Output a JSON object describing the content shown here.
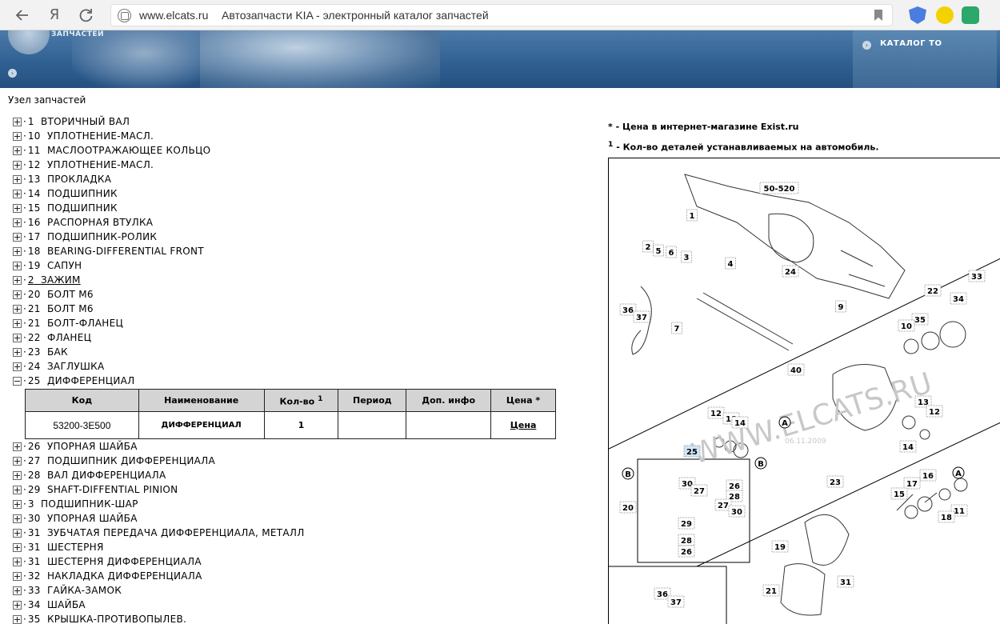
{
  "browser": {
    "back_icon": "arrow-left-icon",
    "yandex_label": "Я",
    "reload_icon": "reload-icon",
    "url": "www.elcats.ru",
    "page_title": "Автозапчасти KIA - электронный каталог запчастей"
  },
  "banner": {
    "brand_sub": "ЗАПЧАСТЕЙ",
    "catalog_to": "КАТАЛОГ ТО"
  },
  "section_title": "Узел запчастей",
  "tree_top": [
    {
      "num": "1",
      "label": "ВТОРИЧНЫЙ ВАЛ"
    },
    {
      "num": "10",
      "label": "УПЛОТНЕНИЕ-МАСЛ."
    },
    {
      "num": "11",
      "label": "МАСЛООТРАЖАЮЩЕЕ КОЛЬЦО"
    },
    {
      "num": "12",
      "label": "УПЛОТНЕНИЕ-МАСЛ."
    },
    {
      "num": "13",
      "label": "ПРОКЛАДКА"
    },
    {
      "num": "14",
      "label": "ПОДШИПНИК"
    },
    {
      "num": "15",
      "label": "ПОДШИПНИК"
    },
    {
      "num": "16",
      "label": "РАСПОРНАЯ ВТУЛКА"
    },
    {
      "num": "17",
      "label": "ПОДШИПНИК-РОЛИК"
    },
    {
      "num": "18",
      "label": "BEARING-DIFFERENTIAL FRONT"
    },
    {
      "num": "19",
      "label": "САПУН"
    },
    {
      "num": "2",
      "label": "ЗАЖИМ"
    },
    {
      "num": "20",
      "label": "БОЛТ М6"
    },
    {
      "num": "21",
      "label": "БОЛТ М6"
    },
    {
      "num": "21",
      "label": "БОЛТ-ФЛАНЕЦ"
    },
    {
      "num": "22",
      "label": "ФЛАНЕЦ"
    },
    {
      "num": "23",
      "label": "БАК"
    },
    {
      "num": "24",
      "label": "ЗАГЛУШКА"
    },
    {
      "num": "25",
      "label": "ДИФФЕРЕНЦИАЛ"
    }
  ],
  "parts_table": {
    "headers": {
      "code": "Код",
      "name": "Наименование",
      "qty": "Кол-во",
      "qty_sup": "1",
      "period": "Период",
      "info": "Доп. инфо",
      "price": "Цена *"
    },
    "row": {
      "code": "53200-3E500",
      "name": "ДИФФЕРЕНЦИАЛ",
      "qty": "1",
      "period": "",
      "info": "",
      "price": "Цена"
    }
  },
  "tree_bottom": [
    {
      "num": "26",
      "label": "УПОРНАЯ ШАЙБА"
    },
    {
      "num": "27",
      "label": "ПОДШИПНИК ДИФФЕРЕНЦИАЛА"
    },
    {
      "num": "28",
      "label": "ВАЛ ДИФФЕРЕНЦИАЛА"
    },
    {
      "num": "29",
      "label": "SHAFT-DIFFENTIAL PINION"
    },
    {
      "num": "3",
      "label": "ПОДШИПНИК-ШАР"
    },
    {
      "num": "30",
      "label": "УПОРНАЯ ШАЙБА"
    },
    {
      "num": "31",
      "label": "ЗУБЧАТАЯ ПЕРЕДАЧА ДИФФЕРЕНЦИАЛА, МЕТАЛЛ"
    },
    {
      "num": "31",
      "label": "ШЕСТЕРНЯ"
    },
    {
      "num": "31",
      "label": "ШЕСТЕРНЯ ДИФФЕРЕНЦИАЛА"
    },
    {
      "num": "32",
      "label": "НАКЛАДКА ДИФФЕРЕНЦИАЛА"
    },
    {
      "num": "33",
      "label": "ГАЙКА-ЗАМОК"
    },
    {
      "num": "34",
      "label": "ШАЙБА"
    },
    {
      "num": "35",
      "label": "КРЫШКА-ПРОТИВОПЫЛЕВ."
    }
  ],
  "notes": {
    "price_note": "* - Цена в интернет-магазине Exist.ru",
    "qty_sup": "1",
    "qty_note": " - Кол-во деталей устанавливаемых на автомобиль."
  },
  "diagram": {
    "watermark": "WWW.ELCATS.RU",
    "date_stamp": "06.11.2009",
    "callouts": [
      "50-520",
      "1",
      "2",
      "5",
      "6",
      "3",
      "4",
      "24",
      "33",
      "22",
      "34",
      "36",
      "37",
      "7",
      "9",
      "35",
      "10",
      "40",
      "13",
      "12",
      "14",
      "12",
      "13",
      "14",
      "25",
      "A",
      "B",
      "B",
      "A",
      "23",
      "30",
      "27",
      "26",
      "28",
      "20",
      "27",
      "30",
      "29",
      "28",
      "26",
      "16",
      "17",
      "15",
      "11",
      "18",
      "19",
      "36",
      "37",
      "21",
      "31"
    ]
  }
}
